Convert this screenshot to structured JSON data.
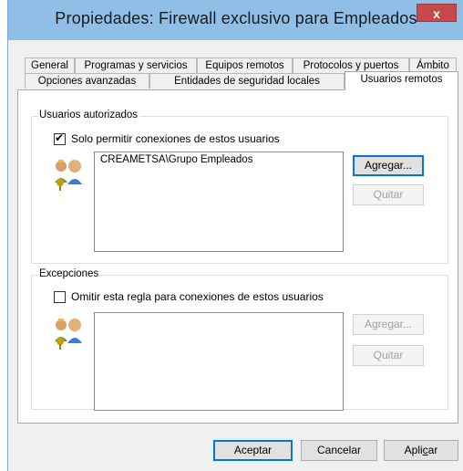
{
  "window": {
    "title": "Propiedades: Firewall exclusivo para Empleados",
    "close_label": "x"
  },
  "tabs": {
    "row1": [
      "General",
      "Programas y servicios",
      "Equipos remotos",
      "Protocolos y puertos",
      "Ámbito"
    ],
    "row2": [
      "Opciones avanzadas",
      "Entidades de seguridad locales",
      "Usuarios remotos"
    ],
    "active": "Usuarios remotos"
  },
  "authorized_users": {
    "group_label": "Usuarios autorizados",
    "checkbox_label": "Solo permitir conexiones de estos usuarios",
    "checked": true,
    "list_items": [
      "CREAMETSA\\Grupo Empleados"
    ],
    "add_label": "Agregar...",
    "remove_label": "Quitar"
  },
  "exceptions": {
    "group_label": "Excepciones",
    "checkbox_label": "Omitir esta regla para conexiones de estos usuarios",
    "checked": false,
    "list_items": [],
    "add_label": "Agregar...",
    "remove_label": "Quitar"
  },
  "footer": {
    "ok_label": "Aceptar",
    "cancel_label": "Cancelar",
    "apply_prefix": "Apli",
    "apply_accel": "c",
    "apply_suffix": "ar"
  },
  "icons": {
    "users": "users-key-icon",
    "check": "✔"
  }
}
